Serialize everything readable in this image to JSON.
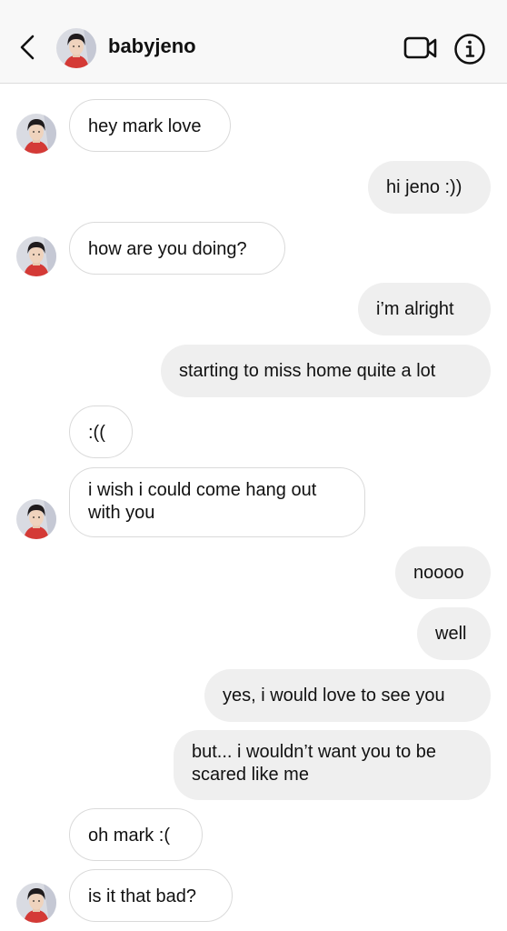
{
  "header": {
    "username": "babyjeno"
  },
  "messages": [
    {
      "text": "hey mark love"
    },
    {
      "text": "hi jeno :))"
    },
    {
      "text": "how are you doing?"
    },
    {
      "text": "i’m alright"
    },
    {
      "text": "starting to miss home quite a lot"
    },
    {
      "text": ":(("
    },
    {
      "text": "i wish i could come hang out with you"
    },
    {
      "text": "noooo"
    },
    {
      "text": "well"
    },
    {
      "text": "yes, i would love to see you"
    },
    {
      "text": "but... i wouldn’t want you to be scared like me"
    },
    {
      "text": "oh mark :("
    },
    {
      "text": "is it that bad?"
    }
  ],
  "icons": {
    "back": "chevron-left-icon",
    "video": "video-camera-icon",
    "info": "info-icon"
  },
  "colors": {
    "incoming_bubble": "#ffffff",
    "incoming_border": "#dadada",
    "outgoing_bubble": "#efefef",
    "header_bg": "#f8f8f8"
  }
}
